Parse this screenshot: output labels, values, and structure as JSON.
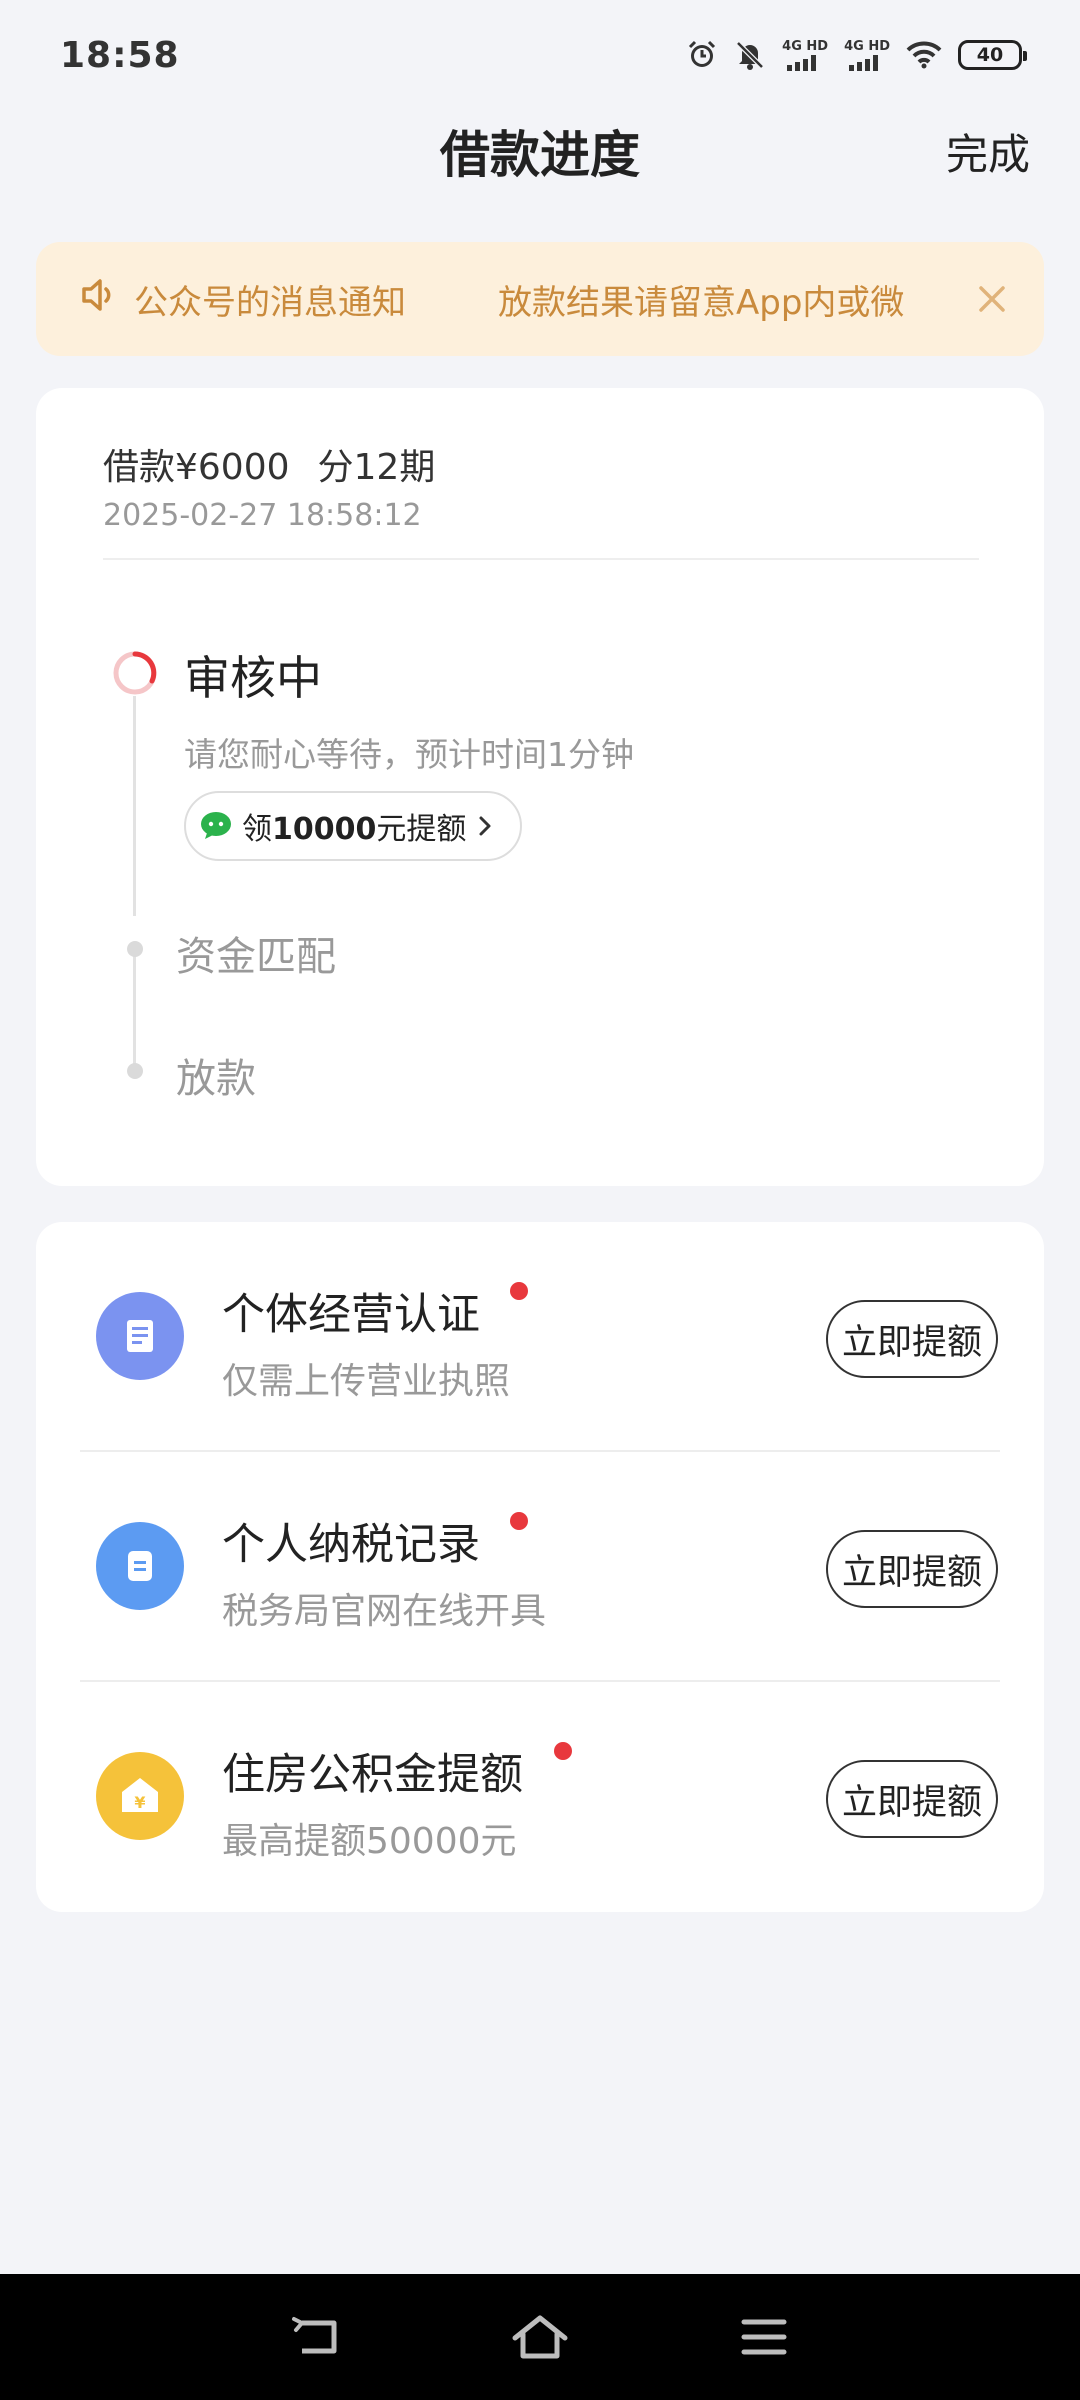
{
  "status_bar": {
    "time": "18:58",
    "network_1": "4G HD",
    "network_2": "4G HD",
    "battery": "40",
    "icons": [
      "alarm-icon",
      "bell-muted-icon",
      "signal-icon",
      "signal-icon",
      "wifi-icon",
      "battery-icon"
    ]
  },
  "nav": {
    "title": "借款进度",
    "done_label": "完成"
  },
  "notice": {
    "segment_1": "公众号的消息通知",
    "segment_2": "放款结果请留意App内或微",
    "icon": "speaker-icon",
    "close_icon": "close-icon",
    "color": "#C98A3C",
    "background": "#FDF0DC"
  },
  "loan": {
    "amount": "借款¥6000",
    "term": "分12期",
    "datetime": "2025-02-27 18:58:12"
  },
  "progress": {
    "steps": [
      {
        "title": "审核中",
        "status": "active"
      },
      {
        "title": "资金匹配",
        "status": "pending"
      },
      {
        "title": "放款",
        "status": "pending"
      }
    ],
    "active_desc": "请您耐心等待，预计时间1分钟",
    "chip_prefix": "领",
    "chip_amount": "10000",
    "chip_suffix": "元提额",
    "chip_icon": "wechat-icon",
    "accent": "#E8383D"
  },
  "offers": {
    "button_label": "立即提额",
    "items": [
      {
        "title": "个体经营认证",
        "subtitle": "仅需上传营业执照",
        "icon": "document-icon",
        "icon_color": "#7B93F0"
      },
      {
        "title": "个人纳税记录",
        "subtitle": "税务局官网在线开具",
        "icon": "tax-record-icon",
        "icon_color": "#5C9BF2"
      },
      {
        "title": "住房公积金提额",
        "subtitle": "最高提额50000元",
        "icon": "housing-fund-icon",
        "icon_color": "#F5C23A"
      }
    ]
  },
  "system_nav": {
    "icons": [
      "back-icon",
      "home-icon",
      "menu-icon"
    ]
  }
}
